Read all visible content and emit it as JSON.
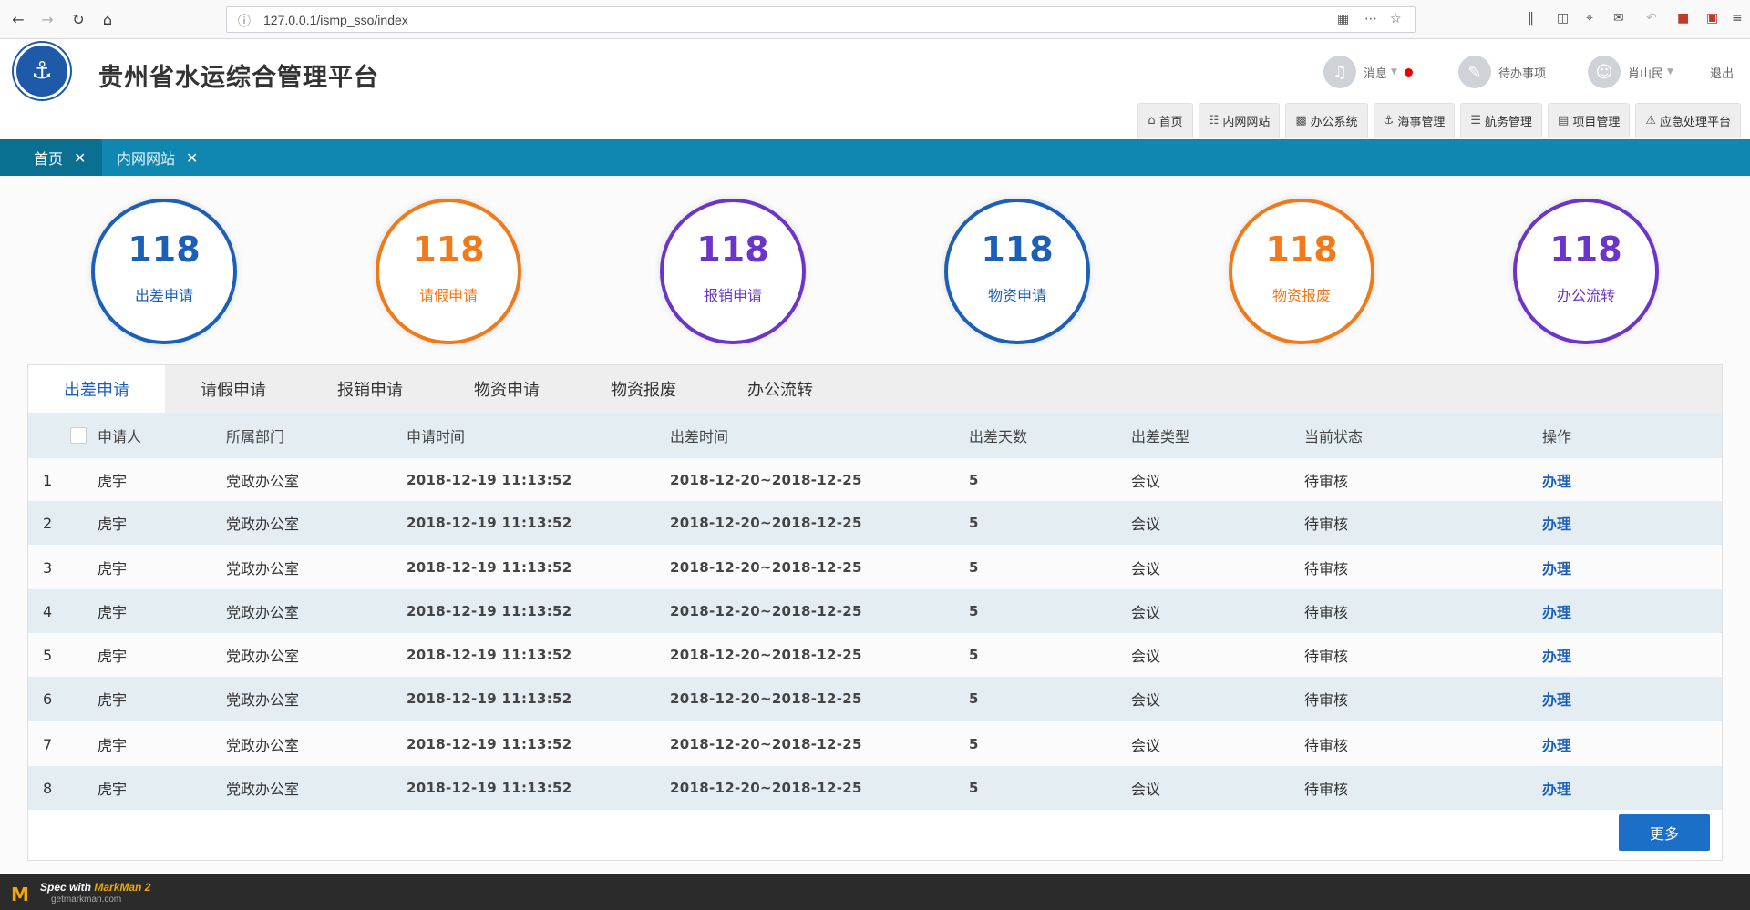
{
  "browser": {
    "url": "127.0.0.1/ismp_sso/index"
  },
  "header": {
    "title": "贵州省水运综合管理平台",
    "message_label": "消息",
    "todo_label": "待办事项",
    "user_name": "肖山民",
    "logout_label": "退出",
    "nav": [
      {
        "label": "首页",
        "icon": "home-icon"
      },
      {
        "label": "内网网站",
        "icon": "sitemap-icon"
      },
      {
        "label": "办公系统",
        "icon": "briefcase-icon"
      },
      {
        "label": "海事管理",
        "icon": "ship-icon"
      },
      {
        "label": "航务管理",
        "icon": "database-icon"
      },
      {
        "label": "项目管理",
        "icon": "list-icon"
      },
      {
        "label": "应急处理平台",
        "icon": "warning-icon"
      }
    ]
  },
  "tabs": [
    {
      "label": "首页"
    },
    {
      "label": "内网网站"
    }
  ],
  "stats": [
    {
      "value": "118",
      "label": "出差申请",
      "color": "#1b5fb8"
    },
    {
      "value": "118",
      "label": "请假申请",
      "color": "#f07a1a"
    },
    {
      "value": "118",
      "label": "报销申请",
      "color": "#6b35c9"
    },
    {
      "value": "118",
      "label": "物资申请",
      "color": "#1b5fb8"
    },
    {
      "value": "118",
      "label": "物资报废",
      "color": "#f07a1a"
    },
    {
      "value": "118",
      "label": "办公流转",
      "color": "#6b35c9"
    }
  ],
  "panel_tabs": [
    "出差申请",
    "请假申请",
    "报销申请",
    "物资申请",
    "物资报废",
    "办公流转"
  ],
  "table": {
    "columns": [
      "申请人",
      "所属部门",
      "申请时间",
      "出差时间",
      "出差天数",
      "出差类型",
      "当前状态",
      "操作"
    ],
    "rows": [
      {
        "no": "1",
        "name": "虎宇",
        "dept": "党政办公室",
        "apply_time": "2018-12-19  11:13:52",
        "trip_time": "2018-12-20~2018-12-25",
        "days": "5",
        "type": "会议",
        "status": "待审核",
        "action": "办理"
      },
      {
        "no": "2",
        "name": "虎宇",
        "dept": "党政办公室",
        "apply_time": "2018-12-19  11:13:52",
        "trip_time": "2018-12-20~2018-12-25",
        "days": "5",
        "type": "会议",
        "status": "待审核",
        "action": "办理"
      },
      {
        "no": "3",
        "name": "虎宇",
        "dept": "党政办公室",
        "apply_time": "2018-12-19  11:13:52",
        "trip_time": "2018-12-20~2018-12-25",
        "days": "5",
        "type": "会议",
        "status": "待审核",
        "action": "办理"
      },
      {
        "no": "4",
        "name": "虎宇",
        "dept": "党政办公室",
        "apply_time": "2018-12-19  11:13:52",
        "trip_time": "2018-12-20~2018-12-25",
        "days": "5",
        "type": "会议",
        "status": "待审核",
        "action": "办理"
      },
      {
        "no": "5",
        "name": "虎宇",
        "dept": "党政办公室",
        "apply_time": "2018-12-19  11:13:52",
        "trip_time": "2018-12-20~2018-12-25",
        "days": "5",
        "type": "会议",
        "status": "待审核",
        "action": "办理"
      },
      {
        "no": "6",
        "name": "虎宇",
        "dept": "党政办公室",
        "apply_time": "2018-12-19  11:13:52",
        "trip_time": "2018-12-20~2018-12-25",
        "days": "5",
        "type": "会议",
        "status": "待审核",
        "action": "办理"
      },
      {
        "no": "7",
        "name": "虎宇",
        "dept": "党政办公室",
        "apply_time": "2018-12-19  11:13:52",
        "trip_time": "2018-12-20~2018-12-25",
        "days": "5",
        "type": "会议",
        "status": "待审核",
        "action": "办理"
      },
      {
        "no": "8",
        "name": "虎宇",
        "dept": "党政办公室",
        "apply_time": "2018-12-19  11:13:52",
        "trip_time": "2018-12-20~2018-12-25",
        "days": "5",
        "type": "会议",
        "status": "待审核",
        "action": "办理"
      }
    ]
  },
  "more_label": "更多",
  "footer": {
    "spec_text": "Spec with",
    "brand": "MarkMan 2",
    "site": "getmarkman.com"
  }
}
